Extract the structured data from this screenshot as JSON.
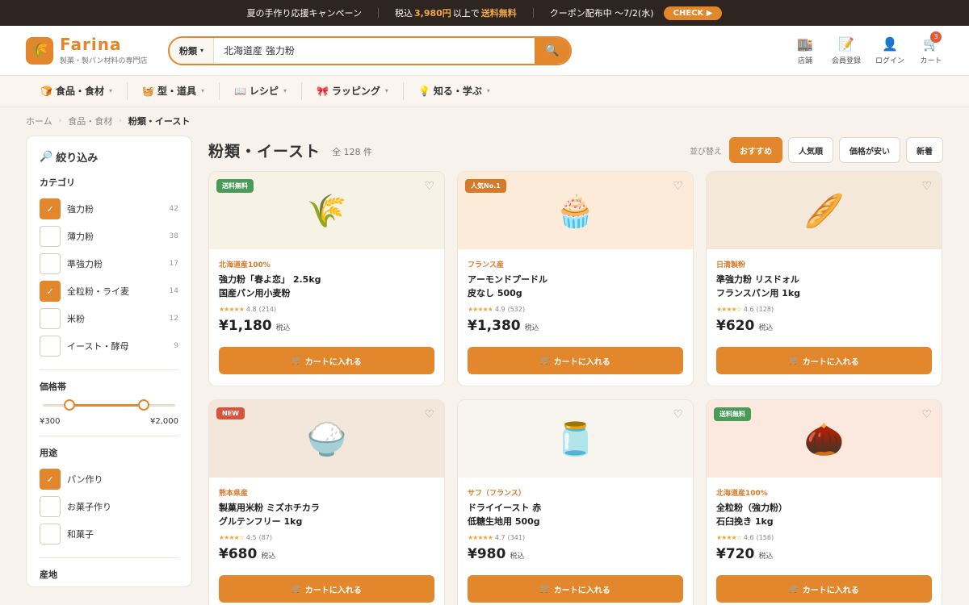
{
  "banner": {
    "campaign": "夏の手作り応援キャンペーン",
    "ship_pre": "税込",
    "ship_amount": "3,980円",
    "ship_mid": "以上で",
    "ship_free": "送料無料",
    "coupon": "クーポン配布中 〜7/2(水)",
    "check_label": "CHECK ▶"
  },
  "header": {
    "logo_name": "Farina",
    "logo_tagline": "製菓・製パン材料の専門店",
    "search_category": "粉類",
    "search_value": "北海道産 強力粉",
    "icons": [
      {
        "label": "店舗",
        "icon": "store-icon"
      },
      {
        "label": "会員登録",
        "icon": "register-icon"
      },
      {
        "label": "ログイン",
        "icon": "user-icon"
      },
      {
        "label": "カート",
        "icon": "cart-icon",
        "badge": "3"
      }
    ]
  },
  "nav": [
    {
      "label": "食品・食材"
    },
    {
      "label": "型・道具"
    },
    {
      "label": "レシピ"
    },
    {
      "label": "ラッピング"
    },
    {
      "label": "知る・学ぶ"
    }
  ],
  "breadcrumb": [
    "ホーム",
    "食品・食材",
    "粉類・イースト"
  ],
  "sidebar": {
    "title": "絞り込み",
    "category_title": "カテゴリ",
    "categories": [
      {
        "label": "強力粉",
        "count": "42",
        "checked": true
      },
      {
        "label": "薄力粉",
        "count": "38",
        "checked": false
      },
      {
        "label": "準強力粉",
        "count": "17",
        "checked": false
      },
      {
        "label": "全粒粉・ライ麦",
        "count": "14",
        "checked": true
      },
      {
        "label": "米粉",
        "count": "12",
        "checked": false
      },
      {
        "label": "イースト・酵母",
        "count": "9",
        "checked": false
      }
    ],
    "price_title": "価格帯",
    "price_min": "¥300",
    "price_max": "¥2,000",
    "usage_title": "用途",
    "usages": [
      {
        "label": "パン作り",
        "checked": true
      },
      {
        "label": "お菓子作り",
        "checked": false
      },
      {
        "label": "和菓子",
        "checked": false
      }
    ],
    "origin_title": "産地"
  },
  "content": {
    "title": "粉類・イースト",
    "total": "全 128 件",
    "sort_label": "並び替え",
    "sort_options": [
      "おすすめ",
      "人気順",
      "価格が安い",
      "新着"
    ],
    "cart_label": "カートに入れる",
    "tax_label": "税込"
  },
  "products": [
    {
      "tag": "送料無料",
      "origin": "北海道産100%",
      "name1": "強力粉「春よ恋」 2.5kg",
      "name2": "国産パン用小麦粉",
      "stars": "★★★★★",
      "rating": "4.8",
      "reviews": "(214)",
      "price": "¥1,180",
      "emoji": "🌾"
    },
    {
      "tag": "人気No.1",
      "origin": "フランス産",
      "name1": "アーモンドプードル",
      "name2": "皮なし 500g",
      "stars": "★★★★★",
      "rating": "4.9",
      "reviews": "(532)",
      "price": "¥1,380",
      "emoji": "🧁"
    },
    {
      "tag": "",
      "origin": "日清製粉",
      "name1": "準強力粉 リスドォル",
      "name2": "フランスパン用 1kg",
      "stars": "★★★★☆",
      "rating": "4.6",
      "reviews": "(128)",
      "price": "¥620",
      "emoji": "🥖"
    },
    {
      "tag": "NEW",
      "origin": "熊本県産",
      "name1": "製菓用米粉 ミズホチカラ",
      "name2": "グルテンフリー 1kg",
      "stars": "★★★★☆",
      "rating": "4.5",
      "reviews": "(87)",
      "price": "¥680",
      "emoji": "🍚"
    },
    {
      "tag": "",
      "origin": "サフ（フランス）",
      "name1": "ドライイースト 赤",
      "name2": "低糖生地用 500g",
      "stars": "★★★★★",
      "rating": "4.7",
      "reviews": "(341)",
      "price": "¥980",
      "emoji": "🫙"
    },
    {
      "tag": "送料無料",
      "origin": "北海道産100%",
      "name1": "全粒粉（強力粉）",
      "name2": "石臼挽き 1kg",
      "stars": "★★★★☆",
      "rating": "4.6",
      "reviews": "(156)",
      "price": "¥720",
      "emoji": "🌰"
    }
  ],
  "colors": {
    "accent": "#e3872d",
    "topbar": "#2f2520",
    "background": "#f7f3ec"
  }
}
